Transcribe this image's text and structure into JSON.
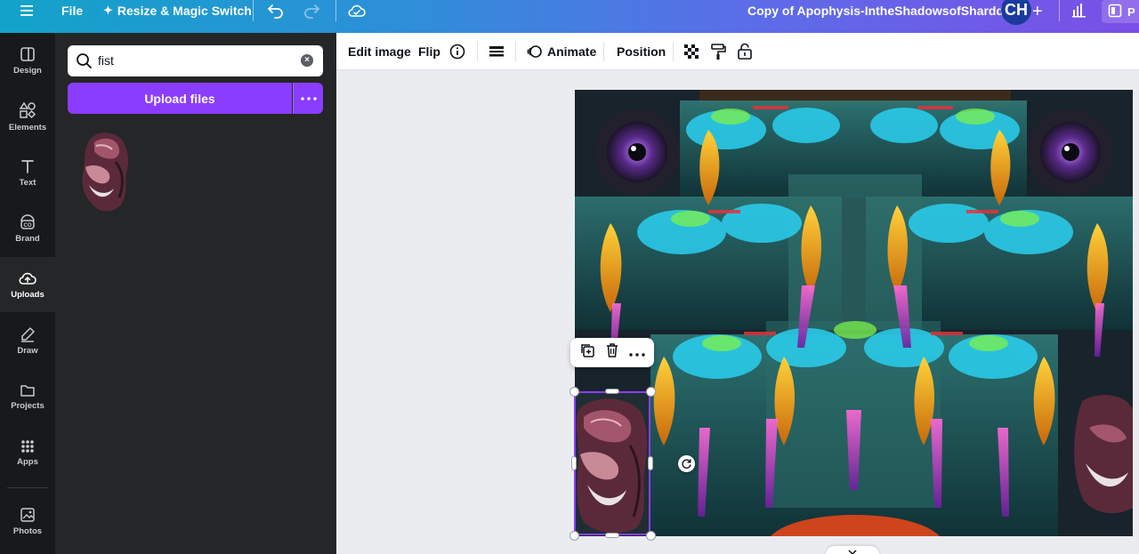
{
  "topbar": {
    "file_label": "File",
    "resize_label": "Resize & Magic Switch",
    "doc_title": "Copy of Apophysis-IntheShadowsofShardds",
    "avatar_initials": "CH",
    "present_label": "P"
  },
  "rail": {
    "items": [
      {
        "label": "Design",
        "icon": "layout-icon"
      },
      {
        "label": "Elements",
        "icon": "shapes-icon"
      },
      {
        "label": "Text",
        "icon": "text-icon"
      },
      {
        "label": "Brand",
        "icon": "brand-icon"
      },
      {
        "label": "Uploads",
        "icon": "cloud-upload-icon"
      },
      {
        "label": "Draw",
        "icon": "pen-icon"
      },
      {
        "label": "Projects",
        "icon": "folder-icon"
      },
      {
        "label": "Apps",
        "icon": "grid-icon"
      },
      {
        "label": "Photos",
        "icon": "image-icon"
      }
    ],
    "active": "Uploads"
  },
  "panel": {
    "search_value": "fist",
    "upload_label": "Upload files"
  },
  "toolbar": {
    "edit_image": "Edit image",
    "flip": "Flip",
    "animate": "Animate",
    "position": "Position"
  },
  "colors": {
    "accent": "#8b3dff",
    "rail_bg": "#18191b",
    "panel_bg": "#252627"
  }
}
